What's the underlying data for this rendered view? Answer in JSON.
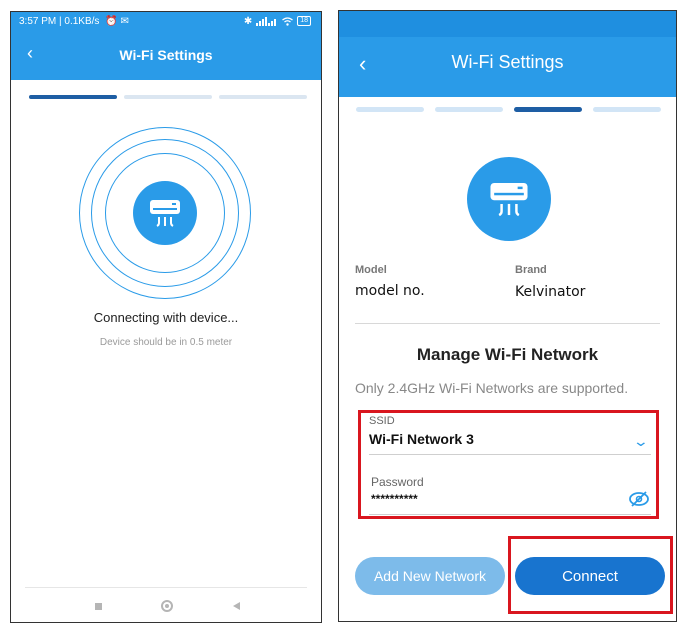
{
  "left_screen": {
    "status_bar": {
      "time_info": "3:57 PM | 0.1KB/s",
      "battery": "18"
    },
    "header": {
      "back_icon": "chevron-left",
      "title": "Wi-Fi Settings"
    },
    "progress": {
      "total_steps": 3,
      "current_step": 1
    },
    "device_icon": "air-conditioner-icon",
    "status_text": "Connecting with device...",
    "hint_text": "Device should be in 0.5 meter",
    "nav_bar": [
      "recent-apps",
      "home",
      "back"
    ]
  },
  "right_screen": {
    "header": {
      "back_icon": "chevron-left",
      "title": "Wi-Fi Settings"
    },
    "progress": {
      "total_steps": 4,
      "current_step": 3
    },
    "device_icon": "air-conditioner-icon",
    "model": {
      "label": "Model",
      "value": "model no."
    },
    "brand": {
      "label": "Brand",
      "value": "Kelvinator"
    },
    "manage_title": "Manage Wi-Fi Network",
    "note": "Only 2.4GHz Wi-Fi Networks are supported.",
    "ssid": {
      "label": "SSID",
      "value": "Wi-Fi Network 3"
    },
    "password": {
      "label": "Password",
      "value": "**********"
    },
    "buttons": {
      "add_network": "Add New Network",
      "connect": "Connect"
    }
  },
  "colors": {
    "primary": "#2a9be8",
    "step_active": "#1e5ea4",
    "connect_button": "#1874cf",
    "add_button": "#7dbbea",
    "highlight": "#d9161f"
  }
}
